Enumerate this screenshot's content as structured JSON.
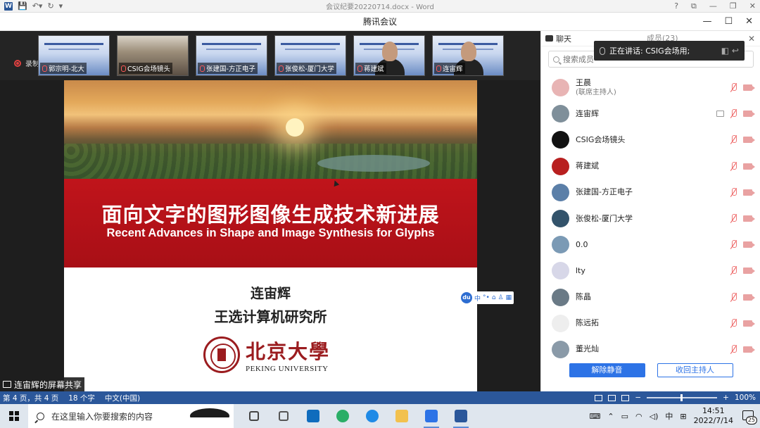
{
  "word": {
    "title": "会议纪要20220714.docx - Word",
    "help": "?",
    "controls": [
      "⧉",
      "—",
      "❐",
      "✕"
    ]
  },
  "meeting": {
    "title": "腾讯会议",
    "controls": [
      "—",
      "☐",
      "✕"
    ]
  },
  "recording": {
    "label": "录制中"
  },
  "video_tiles": [
    {
      "name": "郭宗明-北大",
      "kind": "slide"
    },
    {
      "name": "CSIG会场镜头",
      "kind": "room"
    },
    {
      "name": "张建国-方正电子",
      "kind": "slide"
    },
    {
      "name": "张俊松-厦门大学",
      "kind": "slide"
    },
    {
      "name": "蒋建斌",
      "kind": "person"
    },
    {
      "name": "连宙辉",
      "kind": "person"
    }
  ],
  "slide": {
    "title_cn": "面向文字的图形图像生成技术新进展",
    "title_en": "Recent Advances in Shape and Image Synthesis for Glyphs",
    "presenter": "连宙辉",
    "institute": "王选计算机研究所",
    "logo_cn": "北京大學",
    "logo_en": "PEKING UNIVERSITY"
  },
  "float_toolbar": {
    "badge": "du",
    "items": [
      "中",
      "°•",
      "⌂",
      "♙",
      "▦"
    ]
  },
  "share_label": "连宙辉的屏幕共享",
  "panel": {
    "chat_tab": "聊天",
    "members_tab": "成员(23)",
    "close": "✕",
    "speaking": "正在讲话: CSIG会场用;",
    "search_placeholder": "搜索成员",
    "members": [
      {
        "name": "王晨",
        "sub": "(联席主持人)",
        "avatar_color": "#e8b4b4",
        "screen": false
      },
      {
        "name": "连宙辉",
        "sub": "",
        "avatar_color": "#7f8f9a",
        "screen": true
      },
      {
        "name": "CSIG会场镜头",
        "sub": "",
        "avatar_color": "#111111",
        "screen": false
      },
      {
        "name": "蒋建斌",
        "sub": "",
        "avatar_color": "#b82020",
        "screen": false
      },
      {
        "name": "张建国-方正电子",
        "sub": "",
        "avatar_color": "#5b7fa8",
        "screen": false
      },
      {
        "name": "张俊松-厦门大学",
        "sub": "",
        "avatar_color": "#33536b",
        "screen": false
      },
      {
        "name": "0.0",
        "sub": "",
        "avatar_color": "#7b9ab5",
        "screen": false
      },
      {
        "name": "lty",
        "sub": "",
        "avatar_color": "#d7d7e8",
        "screen": false
      },
      {
        "name": "陈晶",
        "sub": "",
        "avatar_color": "#6a7a86",
        "screen": false
      },
      {
        "name": "陈远拓",
        "sub": "",
        "avatar_color": "#eeeeee",
        "screen": false
      },
      {
        "name": "董光灿",
        "sub": "",
        "avatar_color": "#8a9aa8",
        "screen": false
      }
    ],
    "btn_mute_all": "解除静音",
    "btn_reclaim_host": "收回主持人"
  },
  "status_bar": {
    "page": "第 4 页，共 4 页",
    "words": "18 个字",
    "lang": "中文(中国)",
    "zoom": "100%",
    "zoom_minus": "−",
    "zoom_plus": "+"
  },
  "taskbar": {
    "search_placeholder": "在这里输入你要搜索的内容",
    "time": "14:51",
    "date": "2022/7/14",
    "ime": "中",
    "notifications": "25",
    "apps": [
      {
        "name": "task-view",
        "color": "#444444"
      },
      {
        "name": "widgets",
        "color": "#555555"
      },
      {
        "name": "outlook",
        "color": "#0f6cbd"
      },
      {
        "name": "wechat",
        "color": "#2aae67"
      },
      {
        "name": "edge",
        "color": "#1f8ae6"
      },
      {
        "name": "file-explorer",
        "color": "#f2c14e"
      },
      {
        "name": "tencent-meeting",
        "color": "#2d73e6"
      },
      {
        "name": "word",
        "color": "#2b579a"
      }
    ]
  }
}
